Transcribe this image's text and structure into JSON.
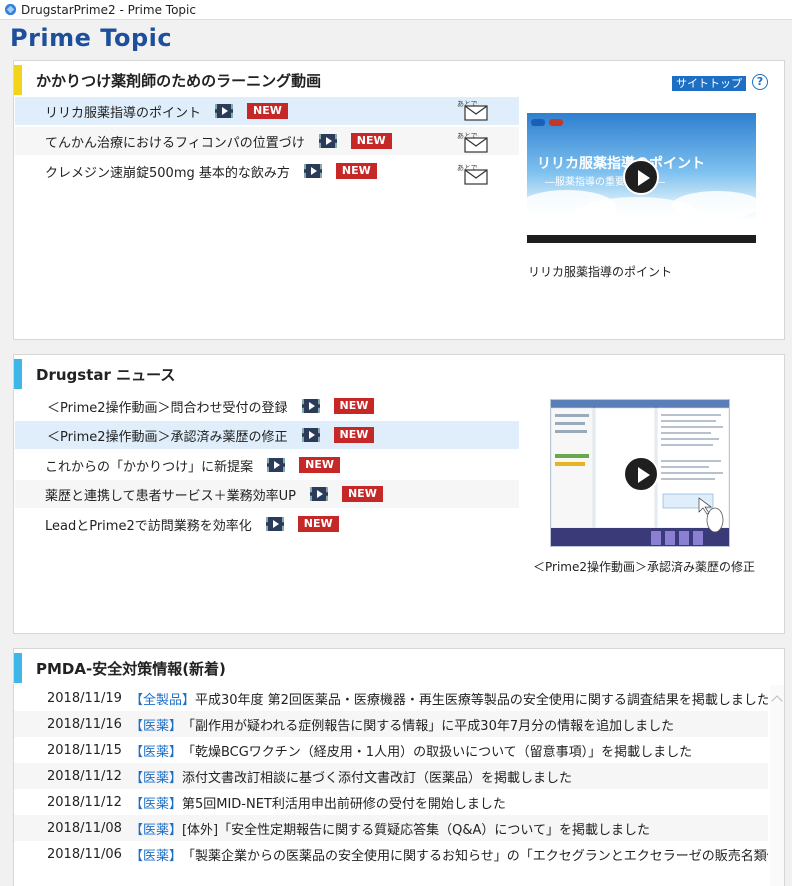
{
  "window": {
    "title": "DrugstarPrime2 - Prime Topic"
  },
  "page": {
    "title": "Prime Topic"
  },
  "learning": {
    "heading": "かかりつけ薬剤師のためのラーニング動画",
    "sitetop_label": "サイトトップ",
    "help_label": "?",
    "later_label": "あとで",
    "new_label": "NEW",
    "items": [
      {
        "label": "リリカ服薬指導のポイント"
      },
      {
        "label": "てんかん治療におけるフィコンパの位置づけ"
      },
      {
        "label": "クレメジン速崩錠500mg 基本的な飲み方"
      }
    ],
    "thumb_caption": "リリカ服薬指導のポイント",
    "thumb_title": "リリカ服薬指導のポイント",
    "thumb_sub": "―服薬指導の重要な役割―"
  },
  "news": {
    "heading": "Drugstar ニュース",
    "new_label": "NEW",
    "items": [
      {
        "label": "＜Prime2操作動画＞問合わせ受付の登録"
      },
      {
        "label": "＜Prime2操作動画＞承認済み薬歴の修正"
      },
      {
        "label": "これからの「かかりつけ」に新提案"
      },
      {
        "label": "薬歴と連携して患者サービス＋業務効率UP"
      },
      {
        "label": "LeadとPrime2で訪問業務を効率化"
      }
    ],
    "thumb_caption": "＜Prime2操作動画＞承認済み薬歴の修正"
  },
  "pmda": {
    "heading": "PMDA-安全対策情報(新着)",
    "rows": [
      {
        "date": "2018/11/19",
        "cat": "【全製品】",
        "text": "平成30年度 第2回医薬品・医療機器・再生医療等製品の安全使用に関する調査結果を掲載しました"
      },
      {
        "date": "2018/11/16",
        "cat": "【医薬】",
        "text": "「副作用が疑われる症例報告に関する情報」に平成30年7月分の情報を追加しました"
      },
      {
        "date": "2018/11/15",
        "cat": "【医薬】",
        "text": "「乾燥BCGワクチン（経皮用・1人用）の取扱いについて（留意事項）」を掲載しました"
      },
      {
        "date": "2018/11/12",
        "cat": "【医薬】",
        "text": "添付文書改訂相談に基づく添付文書改訂（医薬品）を掲載しました"
      },
      {
        "date": "2018/11/12",
        "cat": "【医薬】",
        "text": "第5回MID-NET利活用申出前研修の受付を開始しました"
      },
      {
        "date": "2018/11/08",
        "cat": "【医薬】",
        "text": "[体外]「安全性定期報告に関する質疑応答集（Q&A）について」を掲載しました"
      },
      {
        "date": "2018/11/06",
        "cat": "【医薬】",
        "text": "「製薬企業からの医薬品の安全使用に関するお知らせ」の「エクセグランとエクセラーゼの販売名類似による取り..."
      }
    ]
  },
  "colors": {
    "accent_yellow": "#f2d51a",
    "accent_cyan": "#3fb6e8",
    "title_blue": "#1d4f9a",
    "link_blue": "#1d6fc4",
    "new_red": "#c62828"
  }
}
